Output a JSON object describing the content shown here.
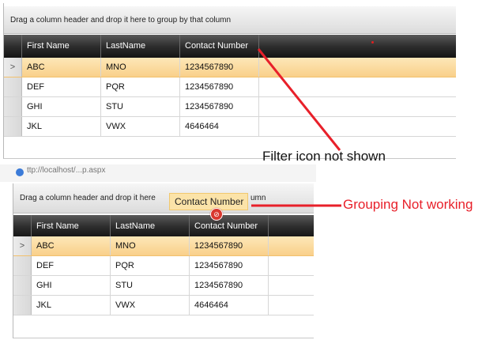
{
  "grid_top": {
    "group_panel_text": "Drag a column header and drop it here to group by that column",
    "columns": [
      "First Name",
      "LastName",
      "Contact Number"
    ],
    "rows": [
      {
        "first": "ABC",
        "last": "MNO",
        "contact": "1234567890",
        "selected": true
      },
      {
        "first": "DEF",
        "last": "PQR",
        "contact": "1234567890"
      },
      {
        "first": "GHI",
        "last": "STU",
        "contact": "1234567890"
      },
      {
        "first": "JKL",
        "last": "VWX",
        "contact": "4646464"
      }
    ]
  },
  "grid_bottom": {
    "group_panel_text": "Drag a column header and drop it here",
    "group_panel_tail": "umn",
    "drag_ghost_label": "Contact Number",
    "columns": [
      "First Name",
      "LastName",
      "Contact Number"
    ],
    "rows": [
      {
        "first": "ABC",
        "last": "MNO",
        "contact": "1234567890",
        "selected": true
      },
      {
        "first": "DEF",
        "last": "PQR",
        "contact": "1234567890"
      },
      {
        "first": "GHI",
        "last": "STU",
        "contact": "1234567890"
      },
      {
        "first": "JKL",
        "last": "VWX",
        "contact": "4646464"
      }
    ]
  },
  "annotations": {
    "filter_note": "Filter icon not shown",
    "grouping_note": "Grouping Not working"
  },
  "browser_strip_text": "ttp://localhost/...p.aspx",
  "colors": {
    "annotation_red": "#e8202a",
    "selected_row": "#fbd89a",
    "header_dark": "#1e1e1e"
  },
  "icons": [
    "row-indicator-arrow-icon",
    "no-drop-icon",
    "browser-tab-icon"
  ]
}
